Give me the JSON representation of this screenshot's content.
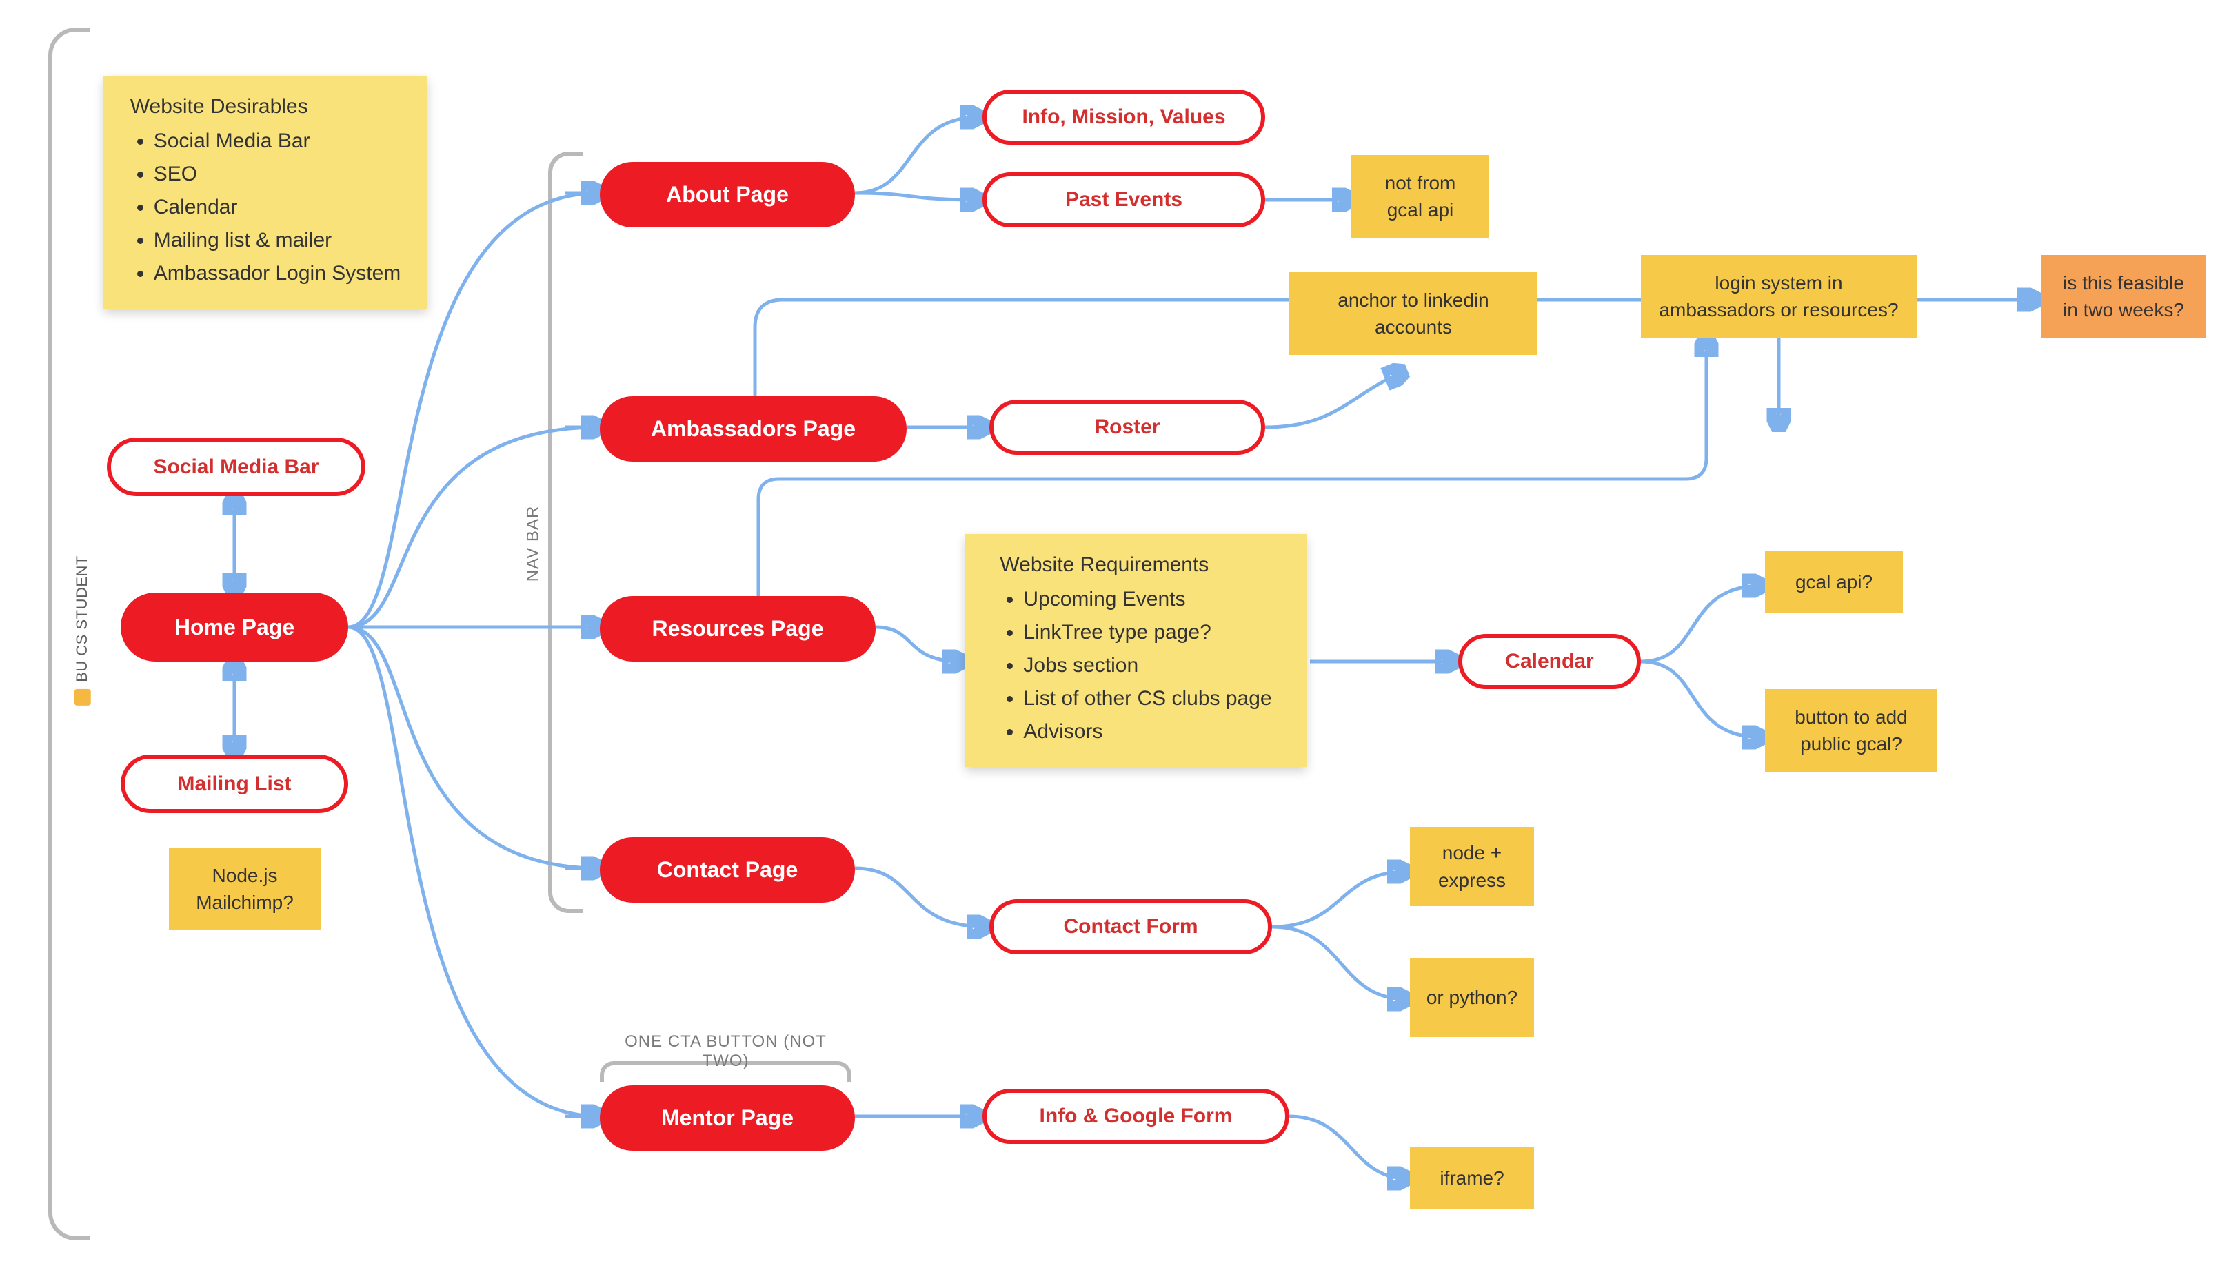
{
  "canvas_label": "BU CS STUDENT",
  "brackets": {
    "nav": "NAV BAR",
    "cta": "ONE CTA BUTTON (NOT TWO)"
  },
  "nodes": {
    "home": "Home Page",
    "social": "Social Media Bar",
    "mailing": "Mailing List",
    "about": "About Page",
    "ambassadors": "Ambassadors Page",
    "resources": "Resources Page",
    "contact": "Contact Page",
    "mentor": "Mentor Page",
    "info_mission": "Info, Mission, Values",
    "past_events": "Past Events",
    "roster": "Roster",
    "calendar": "Calendar",
    "contact_form": "Contact Form",
    "info_gform": "Info & Google Form"
  },
  "stickies": {
    "desirables": {
      "heading": "Website Desirables",
      "items": [
        "Social Media Bar",
        "SEO",
        "Calendar",
        "Mailing list & mailer",
        "Ambassador Login System"
      ]
    },
    "requirements": {
      "heading": "Website Requirements",
      "items": [
        "Upcoming Events",
        "LinkTree type page?",
        "Jobs section",
        "List of other CS clubs page",
        "Advisors"
      ]
    },
    "node_mailchimp": "Node.js Mailchimp?",
    "not_gcal": "not from gcal api",
    "anchor_linkedin": "anchor to linkedin accounts",
    "login_question": "login system in ambassadors or resources?",
    "feasible": "is this feasible in two weeks?",
    "gcal_api": "gcal api?",
    "add_gcal": "button to add public gcal?",
    "node_express": "node + express",
    "or_python": "or python?",
    "iframe": "iframe?"
  }
}
